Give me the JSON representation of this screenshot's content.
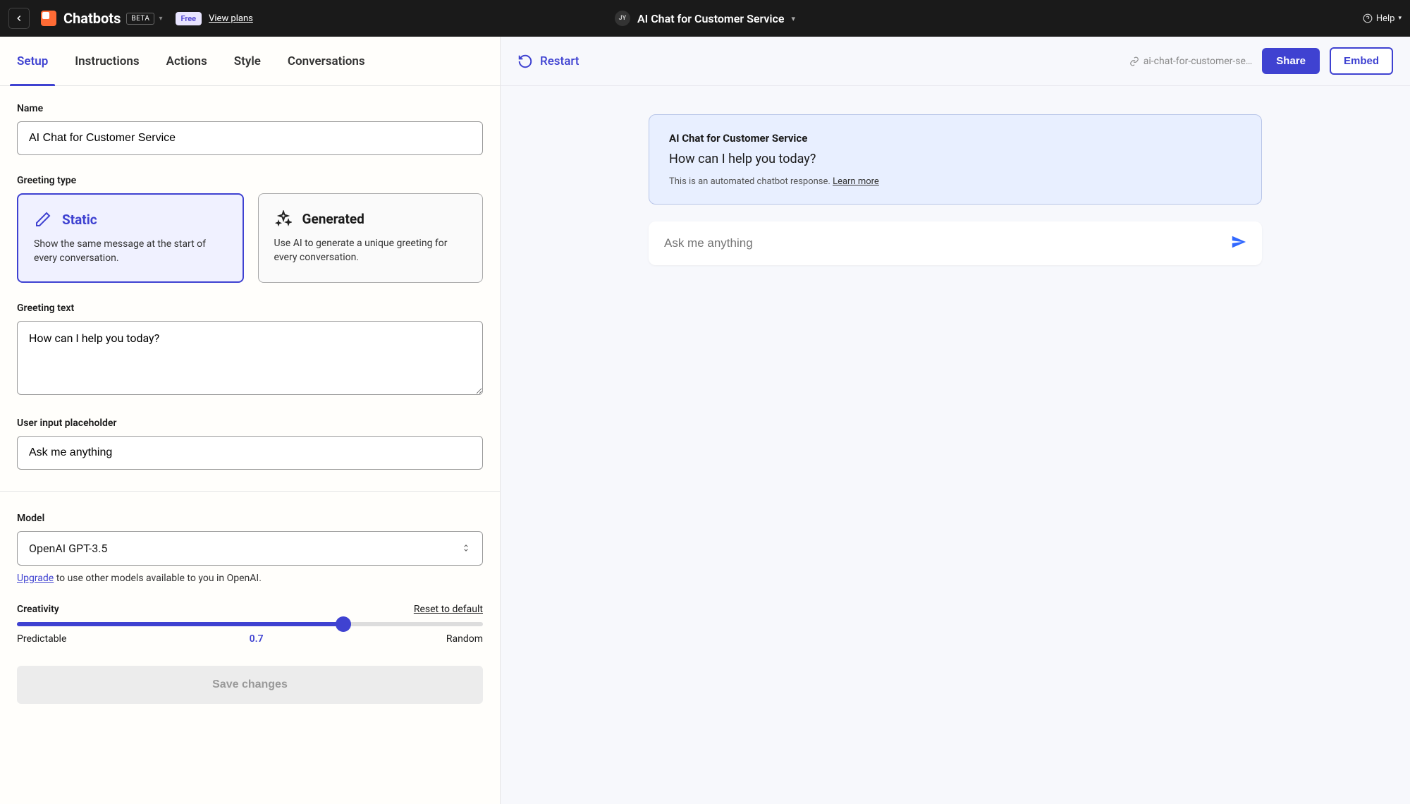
{
  "topbar": {
    "app_name": "Chatbots",
    "beta": "BETA",
    "free_badge": "Free",
    "view_plans": "View plans",
    "avatar_initials": "JY",
    "project_name": "AI Chat for Customer Service",
    "help": "Help"
  },
  "tabs": [
    "Setup",
    "Instructions",
    "Actions",
    "Style",
    "Conversations"
  ],
  "active_tab": 0,
  "form": {
    "name_label": "Name",
    "name_value": "AI Chat for Customer Service",
    "greeting_type_label": "Greeting type",
    "static_card": {
      "title": "Static",
      "desc": "Show the same message at the start of every conversation."
    },
    "generated_card": {
      "title": "Generated",
      "desc": "Use AI to generate a unique greeting for every conversation."
    },
    "greeting_text_label": "Greeting text",
    "greeting_text_value": "How can I help you today?",
    "placeholder_label": "User input placeholder",
    "placeholder_value": "Ask me anything",
    "model_label": "Model",
    "model_value": "OpenAI GPT-3.5",
    "upgrade_link": "Upgrade",
    "upgrade_text": " to use other models available to you in OpenAI.",
    "creativity_label": "Creativity",
    "reset_link": "Reset to default",
    "slider_min_label": "Predictable",
    "slider_max_label": "Random",
    "slider_value": "0.7",
    "save_button": "Save changes"
  },
  "right": {
    "restart": "Restart",
    "slug": "ai-chat-for-customer-se…",
    "share": "Share",
    "embed": "Embed"
  },
  "preview": {
    "title": "AI Chat for Customer Service",
    "message": "How can I help you today?",
    "footer_text": "This is an automated chatbot response. ",
    "learn_more": "Learn more",
    "input_placeholder": "Ask me anything"
  }
}
